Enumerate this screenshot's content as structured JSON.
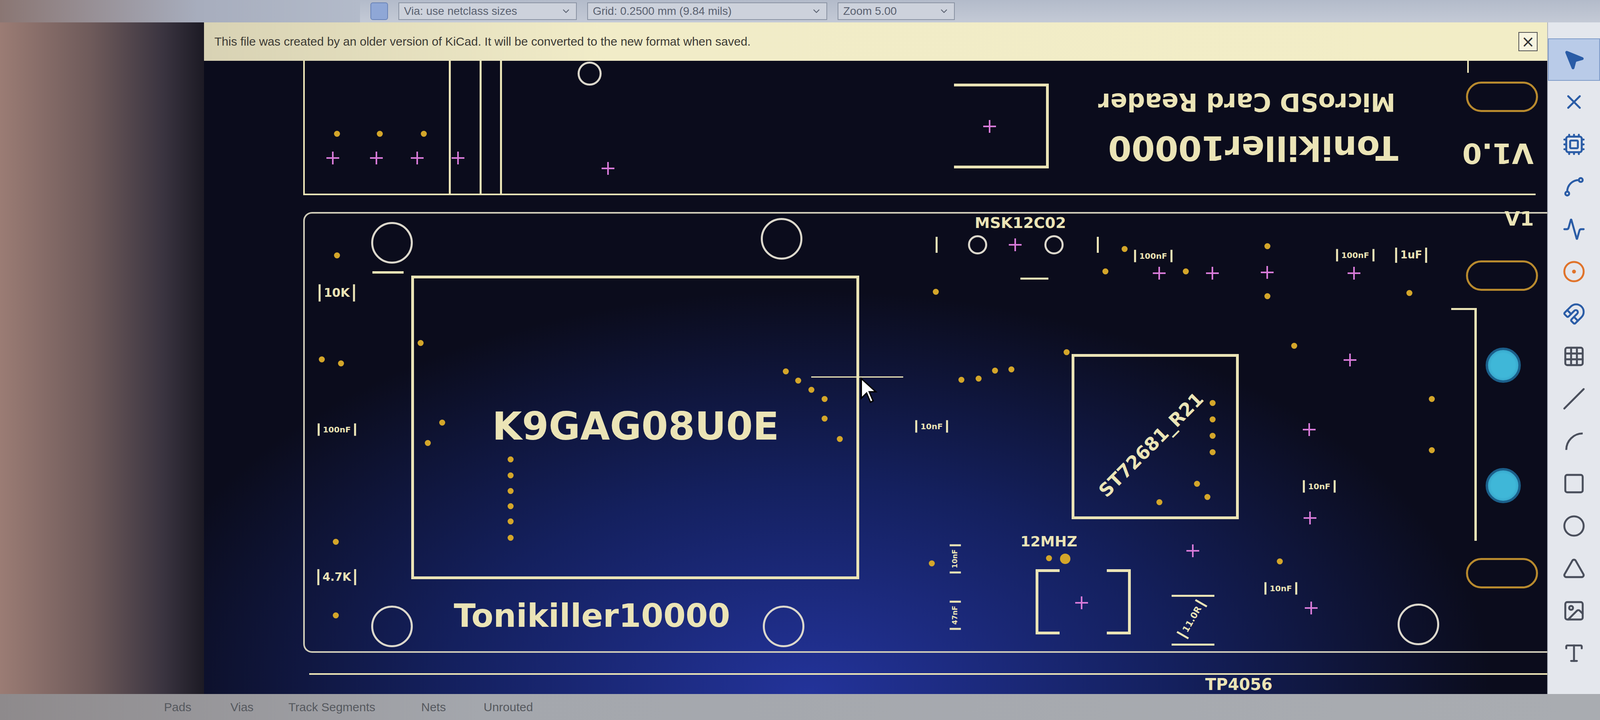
{
  "toolbar": {
    "via_size": "Via: use netclass sizes",
    "grid": "Grid: 0.2500 mm (9.84 mils)",
    "zoom": "Zoom 5.00"
  },
  "infobar": {
    "message": "This file was created by an older version of KiCad. It will be converted to the new format when saved.",
    "close": "×"
  },
  "board": {
    "top_title": "MicroSD Card Reader",
    "top_name": "Tonikiller10000",
    "top_version": "V1.0",
    "edge_version": "V1",
    "connector": "MSK12C02",
    "flash_chip": "K9GAG08U0E",
    "controller": "ST72681_R21",
    "bottom_name": "Tonikiller10000",
    "crystal": "12MHZ",
    "charger": "TP4056",
    "values": [
      "10K",
      "100nF",
      "4.7K",
      "100nF",
      "100nF",
      "1uF",
      "10nF",
      "10nF",
      "10nF",
      "10nF",
      "47nF",
      "11.0R"
    ]
  },
  "tools": [
    {
      "kind": "select",
      "selected": true
    },
    {
      "kind": "ratsnest",
      "selected": false
    },
    {
      "kind": "footprint",
      "selected": false
    },
    {
      "kind": "route",
      "selected": false
    },
    {
      "kind": "tune",
      "selected": false
    },
    {
      "kind": "via",
      "selected": false
    },
    {
      "kind": "pad",
      "selected": false
    },
    {
      "kind": "zone",
      "selected": false
    },
    {
      "kind": "line",
      "selected": false
    },
    {
      "kind": "arc",
      "selected": false
    },
    {
      "kind": "rect",
      "selected": false
    },
    {
      "kind": "circle",
      "selected": false
    },
    {
      "kind": "polygon",
      "selected": false
    },
    {
      "kind": "image",
      "selected": false
    },
    {
      "kind": "text",
      "selected": false
    }
  ],
  "status_bar": {
    "labels": [
      "Pads",
      "Vias",
      "Track Segments",
      "Nets",
      "Unrouted"
    ]
  }
}
